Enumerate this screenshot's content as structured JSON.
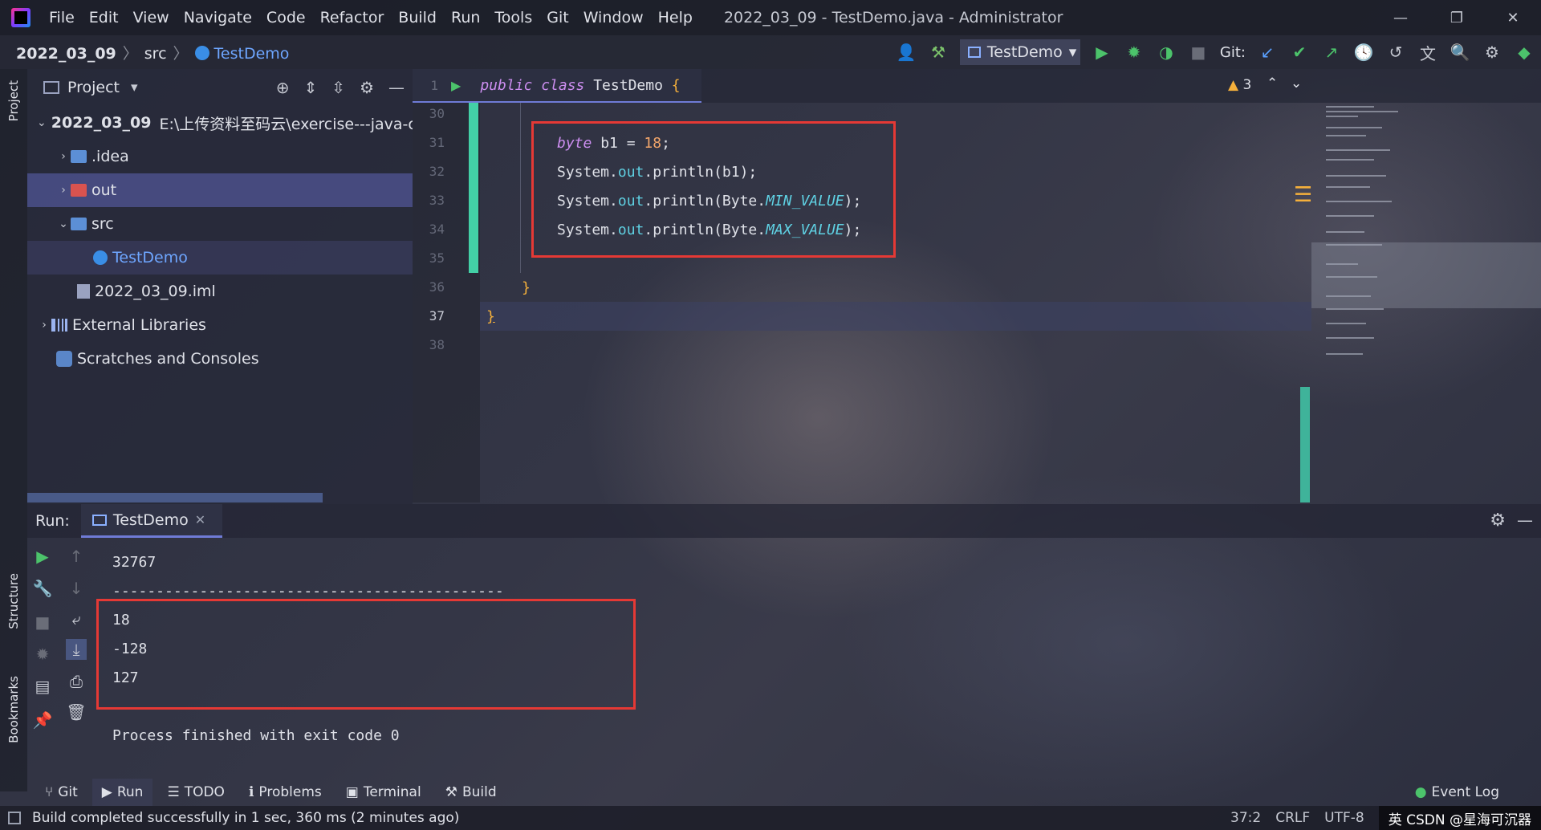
{
  "window": {
    "title": "2022_03_09 - TestDemo.java - Administrator",
    "menu": [
      "File",
      "Edit",
      "View",
      "Navigate",
      "Code",
      "Refactor",
      "Build",
      "Run",
      "Tools",
      "Git",
      "Window",
      "Help"
    ],
    "controls": {
      "minimize": "—",
      "restore": "❐",
      "close": "✕"
    }
  },
  "breadcrumb": {
    "project": "2022_03_09",
    "folder": "src",
    "file": "TestDemo"
  },
  "toolbar": {
    "run_config": "TestDemo",
    "git_label": "Git:"
  },
  "project_panel": {
    "title": "Project",
    "tree": [
      {
        "label": "2022_03_09",
        "path": "E:\\上传资料至码云\\exercise---java-c"
      },
      {
        "label": ".idea"
      },
      {
        "label": "out"
      },
      {
        "label": "src"
      },
      {
        "label": "TestDemo"
      },
      {
        "label": "2022_03_09.iml"
      },
      {
        "label": "External Libraries"
      },
      {
        "label": "Scratches and Consoles"
      }
    ]
  },
  "editor": {
    "tab_line_number": "1",
    "tab_code": {
      "kw1": "public",
      "kw2": "class",
      "name": "TestDemo",
      "brace": "{"
    },
    "line_numbers": [
      "30",
      "31",
      "32",
      "33",
      "34",
      "35",
      "36",
      "37",
      "38"
    ],
    "lines": {
      "l31": {
        "kw": "byte",
        "rest": " b1 = ",
        "num": "18",
        "end": ";"
      },
      "l32": {
        "a": "System.",
        "f": "out",
        "b": ".println(b1);"
      },
      "l33": {
        "a": "System.",
        "f": "out",
        "b": ".println(Byte.",
        "c": "MIN_VALUE",
        "d": ");"
      },
      "l34": {
        "a": "System.",
        "f": "out",
        "b": ".println(Byte.",
        "c": "MAX_VALUE",
        "d": ");"
      },
      "l36": "}",
      "l37": "}"
    },
    "warnings": "3"
  },
  "run_panel": {
    "label": "Run:",
    "tab": "TestDemo",
    "output": {
      "prev": "32767",
      "separator": "---------------------------------------------",
      "results": [
        "18",
        "-128",
        "127"
      ],
      "finished": "Process finished with exit code 0"
    }
  },
  "side_labels": {
    "project": "Project",
    "structure": "Structure",
    "bookmarks": "Bookmarks"
  },
  "bottom_tabs": [
    "Git",
    "Run",
    "TODO",
    "Problems",
    "Terminal",
    "Build"
  ],
  "event_log": "Event Log",
  "status": {
    "message": "Build completed successfully in 1 sec, 360 ms (2 minutes ago)",
    "position": "37:2",
    "line_sep": "CRLF",
    "encoding": "UTF-8",
    "watermark": "英 CSDN @星海可沉器"
  },
  "colors": {
    "accent": "#6f7bd6",
    "change": "#43d0a6",
    "highlight": "#e53935"
  }
}
